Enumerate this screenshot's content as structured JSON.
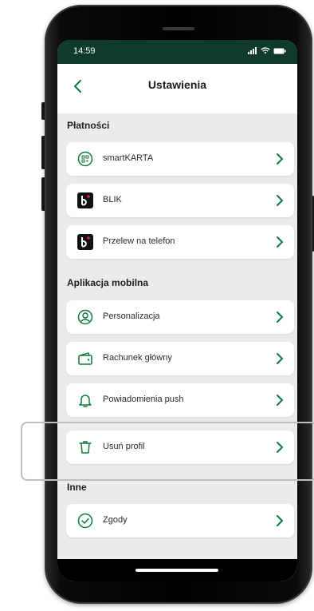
{
  "status": {
    "time": "14:59"
  },
  "header": {
    "title": "Ustawienia"
  },
  "sections": {
    "payments": {
      "label": "Płatności",
      "items": [
        {
          "label": "smartKARTA",
          "icon": "qr-card-icon"
        },
        {
          "label": "BLIK",
          "icon": "blik-icon"
        },
        {
          "label": "Przelew na telefon",
          "icon": "blik-icon"
        }
      ]
    },
    "mobile": {
      "label": "Aplikacja mobilna",
      "items": [
        {
          "label": "Personalizacja",
          "icon": "person-icon"
        },
        {
          "label": "Rachunek główny",
          "icon": "wallet-icon"
        },
        {
          "label": "Powiadomienia push",
          "icon": "bell-icon"
        },
        {
          "label": "Usuń profil",
          "icon": "trash-icon"
        }
      ]
    },
    "other": {
      "label": "Inne",
      "items": [
        {
          "label": "Zgody",
          "icon": "check-circle-icon"
        }
      ]
    }
  },
  "colors": {
    "accent": "#0e7a3a",
    "status_bar": "#0f3a2e",
    "background": "#ebebeb"
  }
}
